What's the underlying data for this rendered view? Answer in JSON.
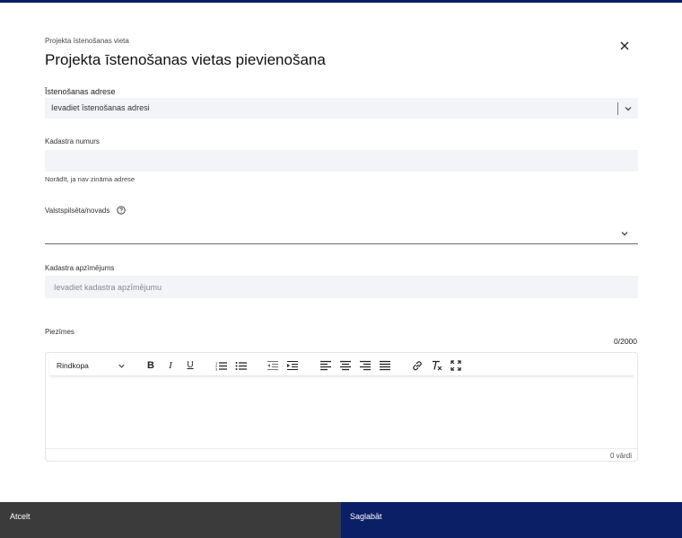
{
  "header": {
    "breadcrumb": "Projekta īstenošanas vieta",
    "title": "Projekta īstenošanas vietas pievienošana"
  },
  "address": {
    "label": "Īstenošanas adrese",
    "value": "Ievadiet īstenošanas adresi"
  },
  "cadastre_number": {
    "label": "Kadastra numurs",
    "value": "",
    "hint": "Norādīt, ja nav zināma adrese"
  },
  "municipality": {
    "label": "Valstspilsēta/novads",
    "value": ""
  },
  "cadastre_designation": {
    "label": "Kadastra apzīmējums",
    "placeholder": "Ievadiet kadastra apzīmējumu"
  },
  "notes": {
    "label": "Piezīmes",
    "counter": "0/2000",
    "format_select": "Rindkopa",
    "word_count": "0 vārdi"
  },
  "footer": {
    "cancel_label": "Atcelt",
    "save_label": "Saglabāt"
  },
  "colors": {
    "accent": "#0b1f66",
    "cancel_bg": "#3b3b3b",
    "field_bg": "#f3f4f7"
  }
}
